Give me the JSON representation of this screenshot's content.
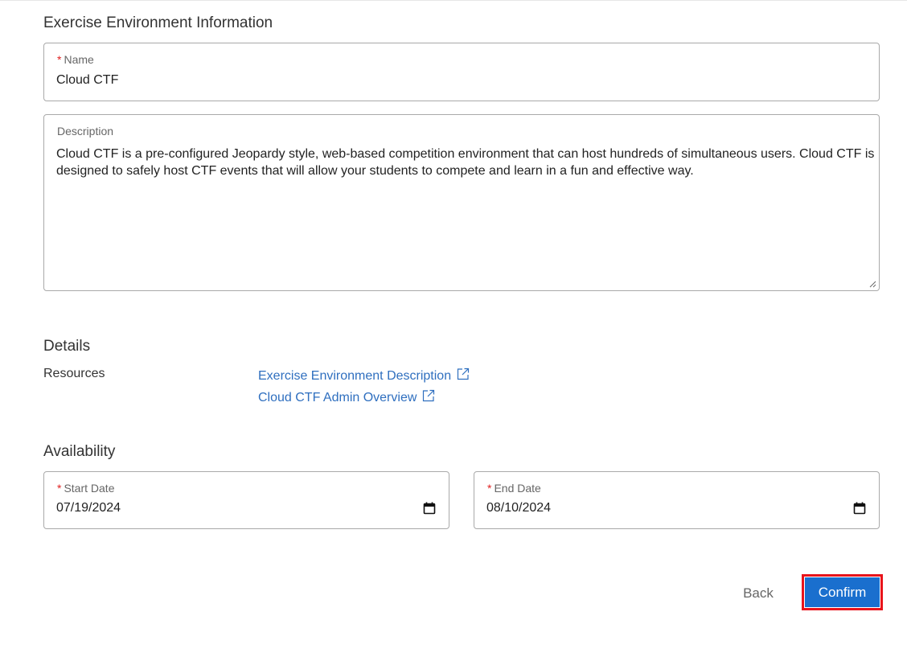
{
  "sections": {
    "environment_title": "Exercise Environment Information",
    "details_title": "Details",
    "availability_title": "Availability"
  },
  "form": {
    "name": {
      "required_mark": "*",
      "label": "Name",
      "value": "Cloud CTF"
    },
    "description": {
      "label": "Description",
      "value": "Cloud CTF is a pre-configured Jeopardy style, web-based competition environment that can host hundreds of simultaneous users. Cloud CTF is designed to safely host CTF events that will allow your students to compete and learn in a fun and effective way."
    },
    "start_date": {
      "required_mark": "*",
      "label": "Start Date",
      "value": "07/19/2024"
    },
    "end_date": {
      "required_mark": "*",
      "label": "End Date",
      "value": "08/10/2024"
    }
  },
  "details": {
    "resources_label": "Resources",
    "links": [
      {
        "label": "Exercise Environment Description",
        "icon": "external-link-icon"
      },
      {
        "label": "Cloud CTF Admin Overview",
        "icon": "external-link-icon"
      }
    ]
  },
  "actions": {
    "back_label": "Back",
    "confirm_label": "Confirm"
  },
  "colors": {
    "link": "#2f6fbf",
    "primary_button": "#1a6fce",
    "highlight_outline": "#e8141b",
    "required_mark": "#e02020"
  }
}
